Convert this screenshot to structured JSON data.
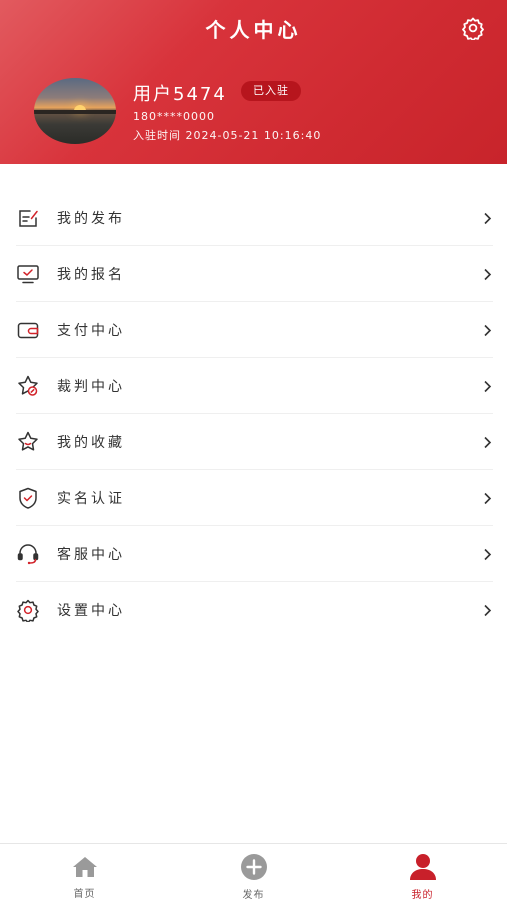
{
  "header": {
    "title": "个人中心",
    "settings_icon": "gear-icon"
  },
  "profile": {
    "username": "用户5474",
    "badge": "已入驻",
    "phone": "180****0000",
    "join_time": "入驻时间 2024-05-21 10:16:40"
  },
  "menu": {
    "items": [
      {
        "label": "我的发布",
        "icon": "edit-document-icon"
      },
      {
        "label": "我的报名",
        "icon": "monitor-check-icon"
      },
      {
        "label": "支付中心",
        "icon": "wallet-icon"
      },
      {
        "label": "裁判中心",
        "icon": "star-badge-icon"
      },
      {
        "label": "我的收藏",
        "icon": "star-icon"
      },
      {
        "label": "实名认证",
        "icon": "shield-check-icon"
      },
      {
        "label": "客服中心",
        "icon": "headset-icon"
      },
      {
        "label": "设置中心",
        "icon": "gear-icon"
      }
    ]
  },
  "tabbar": {
    "tabs": [
      {
        "label": "首页",
        "icon": "home-icon",
        "active": false
      },
      {
        "label": "发布",
        "icon": "plus-circle-icon",
        "active": false
      },
      {
        "label": "我的",
        "icon": "user-icon",
        "active": true
      }
    ]
  },
  "colors": {
    "primary": "#cf2a31",
    "badge_bg": "#b7151d",
    "tab_active": "#c8202a",
    "tab_inactive": "#9a9a9a"
  }
}
